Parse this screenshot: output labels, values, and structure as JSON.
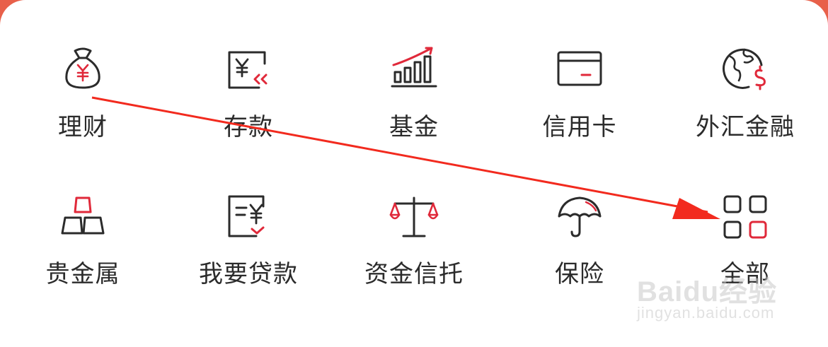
{
  "colors": {
    "accent": "#e0293a",
    "stroke": "#2b2b2b",
    "background": "#ffffff"
  },
  "menu": {
    "items": [
      {
        "label": "理财",
        "icon": "money-bag-yuan-icon"
      },
      {
        "label": "存款",
        "icon": "yuan-deposit-icon"
      },
      {
        "label": "基金",
        "icon": "growth-chart-icon"
      },
      {
        "label": "信用卡",
        "icon": "credit-card-icon"
      },
      {
        "label": "外汇金融",
        "icon": "globe-dollar-icon"
      },
      {
        "label": "贵金属",
        "icon": "gold-bars-icon"
      },
      {
        "label": "我要贷款",
        "icon": "loan-document-icon"
      },
      {
        "label": "资金信托",
        "icon": "balance-scale-icon"
      },
      {
        "label": "保险",
        "icon": "umbrella-icon"
      },
      {
        "label": "全部",
        "icon": "grid-all-icon"
      }
    ]
  },
  "watermark": {
    "brand": "Baidu经验",
    "url": "jingyan.baidu.com"
  }
}
